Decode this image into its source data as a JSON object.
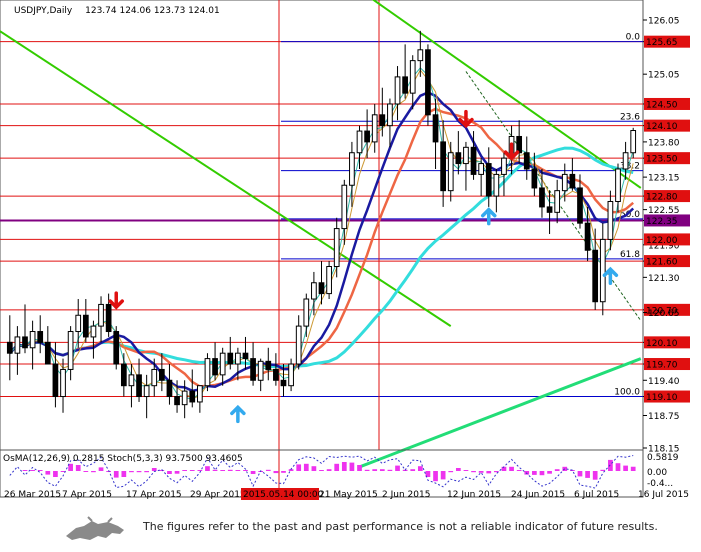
{
  "header": {
    "symbol": "USDJPY,Daily",
    "ohlc": "123.74 124.06 123.73 124.01"
  },
  "indicator": {
    "label": "OsMA(12,26,9) 0.2815 Stoch(5,3,3) 93.7500 93.4605",
    "axis_labels": [
      "0.5819",
      "0.00",
      "-0.4..."
    ]
  },
  "footer": {
    "disclaimer": "The figures refer to the past and past performance is not a reliable indicator of future results."
  },
  "colors": {
    "resistance_line": "#e01010",
    "fibo_line": "#0000cc",
    "pivot_line": "#800080",
    "channel": "#33cc00",
    "ma_fast": "#1a1aa0",
    "ma_mid": "#33dddd",
    "ma_slow": "#ee6644",
    "ma_long": "#22dd77",
    "osma": "#ee33ee",
    "stoch": "#3333cc"
  },
  "chart_data": {
    "type": "candlestick",
    "ylim": [
      118.15,
      126.0
    ],
    "y_ticks": [
      126.05,
      125.65,
      125.05,
      124.5,
      124.1,
      123.8,
      123.5,
      123.15,
      122.8,
      122.55,
      122.35,
      121.9,
      121.6,
      121.3,
      120.7,
      120.65,
      120.1,
      119.7,
      119.4,
      119.1,
      118.75,
      118.15
    ],
    "y_tick_labels": [
      "126.05",
      "125.65",
      "125.05",
      "124.50",
      "124.10",
      "123.80",
      "123.50",
      "123.15",
      "122.80",
      "122.55",
      "122.35",
      "121.90",
      "121.60",
      "121.30",
      "120.70",
      "120.65",
      "120.10",
      "119.70",
      "119.40",
      "119.10",
      "118.75",
      "118.15"
    ],
    "highlighted_levels": [
      125.65,
      124.5,
      124.1,
      123.5,
      122.8,
      122.35,
      122.0,
      121.6,
      120.7,
      120.1,
      119.7,
      119.1
    ],
    "levels": [
      {
        "value": 125.65,
        "label": "125.65",
        "kind": "resistance"
      },
      {
        "value": 124.5,
        "label": "124.50",
        "kind": "resistance"
      },
      {
        "value": 124.1,
        "label": "124.10",
        "kind": "resistance"
      },
      {
        "value": 123.5,
        "label": "123.50",
        "kind": "resistance"
      },
      {
        "value": 122.8,
        "label": "122.80",
        "kind": "resistance"
      },
      {
        "value": 122.35,
        "label": "122.35",
        "kind": "pivot"
      },
      {
        "value": 122.0,
        "label": "122.00",
        "kind": "resistance"
      },
      {
        "value": 121.6,
        "label": "121.60",
        "kind": "resistance"
      },
      {
        "value": 120.7,
        "label": "120.70",
        "kind": "resistance"
      },
      {
        "value": 120.1,
        "label": "120.10",
        "kind": "resistance"
      },
      {
        "value": 119.7,
        "label": "119.70",
        "kind": "resistance"
      },
      {
        "value": 119.1,
        "label": "119.10",
        "kind": "resistance"
      }
    ],
    "fibo": [
      {
        "value": 125.65,
        "label": "0.0"
      },
      {
        "value": 124.18,
        "label": "23.6"
      },
      {
        "value": 123.27,
        "label": "38.2"
      },
      {
        "value": 122.38,
        "label": "50.0"
      },
      {
        "value": 121.64,
        "label": "61.8"
      },
      {
        "value": 119.1,
        "label": "100.0"
      }
    ],
    "x_labels": [
      "26 Mar 2015",
      "7 Apr 2015",
      "17 Apr 2015",
      "29 Apr 2015",
      "2015.05.14 00:00",
      "21 May 2015",
      "2 Jun 2015",
      "12 Jun 2015",
      "24 Jun 2015",
      "6 Jul 2015",
      "16 Jul 2015"
    ],
    "candles": [
      [
        120.1,
        120.6,
        119.4,
        119.9
      ],
      [
        119.9,
        120.4,
        119.5,
        120.2
      ],
      [
        120.2,
        120.8,
        119.9,
        120.0
      ],
      [
        120.0,
        120.5,
        119.6,
        120.3
      ],
      [
        120.3,
        120.6,
        119.9,
        120.1
      ],
      [
        120.1,
        120.4,
        119.7,
        119.7
      ],
      [
        119.7,
        120.1,
        118.9,
        119.1
      ],
      [
        119.1,
        119.8,
        118.8,
        119.6
      ],
      [
        119.6,
        120.4,
        119.4,
        120.3
      ],
      [
        120.3,
        120.9,
        120.0,
        120.6
      ],
      [
        120.6,
        120.9,
        120.1,
        120.2
      ],
      [
        120.2,
        120.5,
        119.8,
        120.4
      ],
      [
        120.4,
        120.95,
        120.1,
        120.8
      ],
      [
        120.8,
        121.0,
        120.2,
        120.3
      ],
      [
        120.3,
        120.4,
        119.6,
        119.7
      ],
      [
        119.7,
        119.9,
        119.1,
        119.3
      ],
      [
        119.3,
        119.7,
        118.9,
        119.5
      ],
      [
        119.5,
        119.8,
        119.0,
        119.1
      ],
      [
        119.1,
        119.5,
        118.7,
        119.3
      ],
      [
        119.3,
        119.8,
        119.1,
        119.6
      ],
      [
        119.6,
        119.9,
        119.2,
        119.4
      ],
      [
        119.4,
        119.7,
        118.95,
        119.1
      ],
      [
        119.1,
        119.4,
        118.8,
        118.95
      ],
      [
        118.95,
        119.4,
        118.7,
        119.2
      ],
      [
        119.2,
        119.6,
        118.9,
        119.0
      ],
      [
        119.0,
        119.3,
        118.8,
        119.3
      ],
      [
        119.3,
        119.9,
        119.2,
        119.8
      ],
      [
        119.8,
        120.1,
        119.4,
        119.5
      ],
      [
        119.5,
        120.0,
        119.3,
        119.9
      ],
      [
        119.9,
        120.2,
        119.6,
        119.7
      ],
      [
        119.7,
        120.0,
        119.4,
        119.9
      ],
      [
        119.9,
        120.2,
        119.6,
        119.8
      ],
      [
        119.8,
        120.1,
        119.3,
        119.4
      ],
      [
        119.4,
        119.8,
        119.2,
        119.75
      ],
      [
        119.75,
        120.0,
        119.4,
        119.6
      ],
      [
        119.6,
        119.9,
        119.3,
        119.4
      ],
      [
        119.4,
        119.7,
        119.1,
        119.3
      ],
      [
        119.3,
        119.8,
        119.2,
        119.7
      ],
      [
        119.7,
        120.6,
        119.6,
        120.4
      ],
      [
        120.4,
        121.0,
        120.2,
        120.9
      ],
      [
        120.9,
        121.4,
        120.6,
        121.2
      ],
      [
        121.2,
        121.6,
        120.8,
        121.0
      ],
      [
        121.0,
        121.6,
        120.9,
        121.5
      ],
      [
        121.5,
        122.4,
        121.3,
        122.2
      ],
      [
        122.2,
        123.1,
        121.9,
        123.0
      ],
      [
        123.0,
        123.8,
        122.6,
        123.6
      ],
      [
        123.6,
        124.1,
        123.3,
        124.0
      ],
      [
        124.0,
        124.4,
        123.5,
        123.8
      ],
      [
        123.8,
        124.5,
        123.6,
        124.3
      ],
      [
        124.3,
        124.8,
        123.9,
        124.1
      ],
      [
        124.1,
        124.6,
        123.7,
        124.5
      ],
      [
        124.5,
        125.2,
        124.2,
        125.0
      ],
      [
        125.0,
        125.6,
        124.6,
        124.7
      ],
      [
        124.7,
        125.4,
        124.4,
        125.3
      ],
      [
        125.3,
        125.85,
        125.0,
        125.5
      ],
      [
        125.5,
        125.6,
        124.1,
        124.3
      ],
      [
        124.3,
        124.6,
        123.3,
        123.8
      ],
      [
        123.8,
        124.2,
        122.6,
        122.9
      ],
      [
        122.9,
        123.8,
        122.7,
        123.6
      ],
      [
        123.6,
        124.0,
        123.2,
        123.4
      ],
      [
        123.4,
        123.8,
        122.9,
        123.7
      ],
      [
        123.7,
        124.0,
        123.1,
        123.2
      ],
      [
        123.2,
        123.5,
        122.8,
        123.4
      ],
      [
        123.4,
        123.7,
        122.6,
        122.8
      ],
      [
        122.8,
        123.3,
        122.5,
        123.2
      ],
      [
        123.2,
        123.6,
        122.8,
        123.5
      ],
      [
        123.5,
        124.1,
        123.2,
        123.9
      ],
      [
        123.9,
        124.2,
        123.4,
        123.6
      ],
      [
        123.6,
        123.9,
        123.1,
        123.3
      ],
      [
        123.3,
        123.6,
        122.8,
        122.95
      ],
      [
        122.95,
        123.3,
        122.4,
        122.6
      ],
      [
        122.6,
        122.9,
        122.1,
        122.5
      ],
      [
        122.5,
        123.1,
        122.3,
        122.9
      ],
      [
        122.9,
        123.4,
        122.7,
        123.2
      ],
      [
        123.2,
        123.5,
        122.9,
        122.95
      ],
      [
        122.95,
        123.2,
        122.2,
        122.3
      ],
      [
        122.3,
        122.6,
        121.6,
        121.8
      ],
      [
        121.8,
        122.2,
        120.7,
        120.85
      ],
      [
        120.85,
        122.3,
        120.6,
        122.0
      ],
      [
        122.0,
        122.9,
        121.8,
        122.7
      ],
      [
        122.7,
        123.4,
        122.5,
        123.3
      ],
      [
        123.3,
        123.8,
        123.1,
        123.6
      ],
      [
        123.6,
        124.06,
        123.5,
        124.01
      ]
    ]
  }
}
